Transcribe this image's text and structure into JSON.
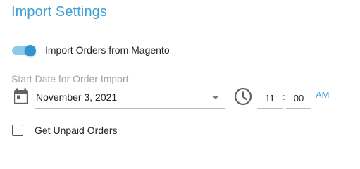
{
  "header": {
    "title": "Import Settings"
  },
  "import_toggle": {
    "label": "Import Orders from Magento",
    "enabled": true
  },
  "start_date": {
    "label": "Start Date for Order Import",
    "value": "November 3, 2021",
    "icon": "calendar-icon"
  },
  "time": {
    "icon": "clock-icon",
    "hour": "11",
    "separator": ":",
    "minute": "00",
    "period": "AM"
  },
  "unpaid_orders": {
    "label": "Get Unpaid Orders",
    "checked": false
  },
  "colors": {
    "accent": "#3d9fd4",
    "toggle_track": "#8cc9ea",
    "toggle_thumb": "#2f97cf",
    "muted_label": "#a3a3a3",
    "text": "#222222"
  }
}
